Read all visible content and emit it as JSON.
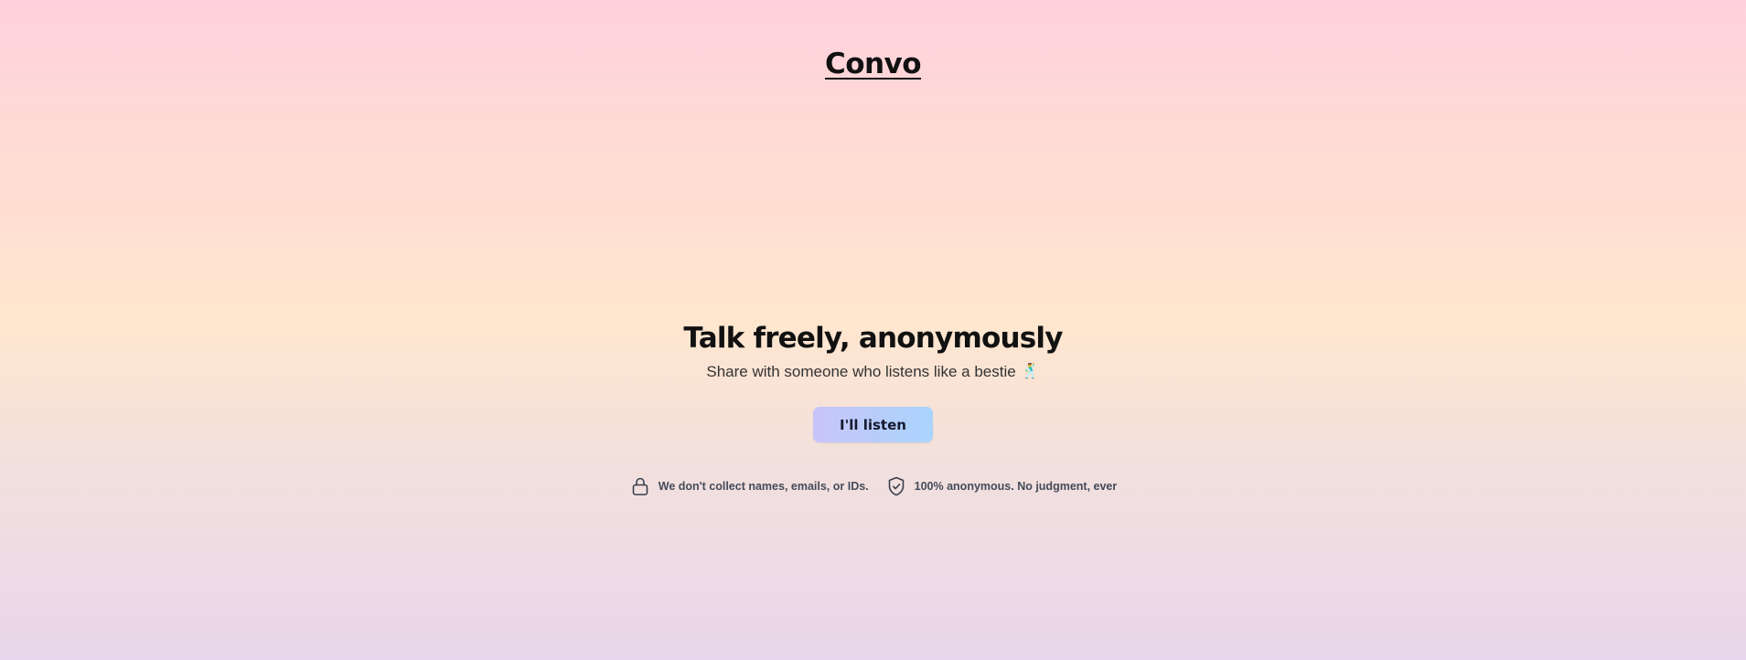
{
  "header": {
    "brand": "Convo"
  },
  "hero": {
    "title": "Talk freely, anonymously",
    "subtitle": "Share with someone who listens like a bestie",
    "subtitle_emoji": "🕺",
    "cta_label": "I'll listen"
  },
  "trust": [
    {
      "icon": "lock-icon",
      "text": "We don't collect names, emails, or IDs."
    },
    {
      "icon": "shield-check-icon",
      "text": "100% anonymous. No judgment, ever"
    }
  ],
  "colors": {
    "gradient_top": "#ffd1dc",
    "gradient_middle": "#ffe6ce",
    "gradient_bottom": "#e8d6ec",
    "button_start": "#c9c4fb",
    "button_end": "#a9d4fd",
    "text_primary": "#111111",
    "text_muted": "#444b59"
  }
}
